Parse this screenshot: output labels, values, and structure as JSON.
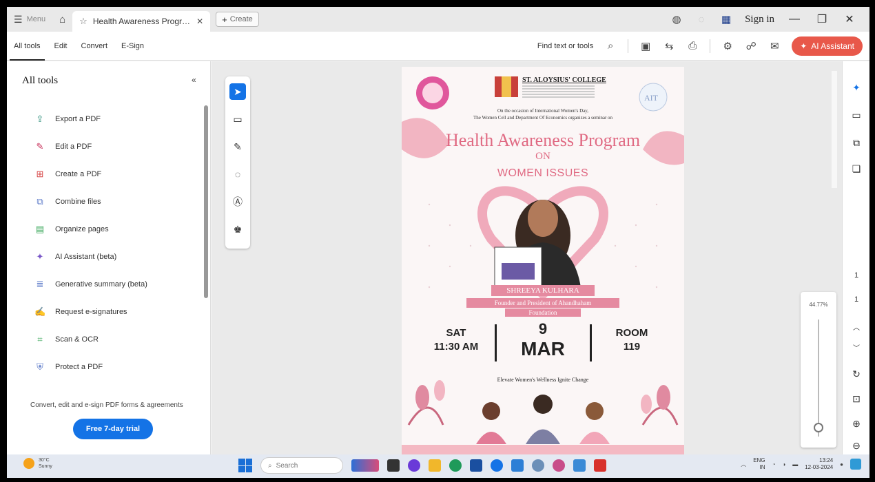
{
  "titlebar": {
    "menu_label": "Menu",
    "tab_title": "Health Awareness Progr…",
    "create_label": "Create",
    "sign_in": "Sign in"
  },
  "toolbar": {
    "tabs": [
      "All tools",
      "Edit",
      "Convert",
      "E-Sign"
    ],
    "find_label": "Find text or tools",
    "ai_label": "AI Assistant"
  },
  "left_panel": {
    "title": "All tools",
    "items": [
      {
        "label": "Export a PDF",
        "icon": "export-pdf-icon",
        "color": "#2d8f7b"
      },
      {
        "label": "Edit a PDF",
        "icon": "edit-pdf-icon",
        "color": "#c8305a"
      },
      {
        "label": "Create a PDF",
        "icon": "create-pdf-icon",
        "color": "#d64545"
      },
      {
        "label": "Combine files",
        "icon": "combine-files-icon",
        "color": "#5a78c8"
      },
      {
        "label": "Organize pages",
        "icon": "organize-pages-icon",
        "color": "#3aa75a"
      },
      {
        "label": "AI Assistant (beta)",
        "icon": "ai-assistant-icon",
        "color": "#7a58c8"
      },
      {
        "label": "Generative summary (beta)",
        "icon": "generative-summary-icon",
        "color": "#5a78c8"
      },
      {
        "label": "Request e-signatures",
        "icon": "request-signatures-icon",
        "color": "#7a58c8"
      },
      {
        "label": "Scan & OCR",
        "icon": "scan-ocr-icon",
        "color": "#3aa75a"
      },
      {
        "label": "Protect a PDF",
        "icon": "protect-pdf-icon",
        "color": "#5a78c8"
      }
    ],
    "promo_text": "Convert, edit and e-sign PDF forms & agreements",
    "trial_button": "Free 7-day trial"
  },
  "poster": {
    "college": "ST. ALOYSIUS' COLLEGE",
    "intro_line1": "On the occasion of International Women's Day,",
    "intro_line2": "The Women Cell and Department Of Economics organizes a seminar on",
    "title": "Health Awareness Program",
    "on": "ON",
    "subtitle": "WOMEN ISSUES",
    "speaker_name": "SHREEYA KULHARA",
    "speaker_role": "Founder and President of Ahandhaham",
    "speaker_role2": "Foundation",
    "day": "SAT",
    "time": "11:30 AM",
    "date": "9",
    "month": "MAR",
    "room_label": "ROOM",
    "room_number": "119",
    "tagline": "Elevate Women's Wellness Ignite Change"
  },
  "zoom": {
    "percent": "44.77%"
  },
  "taskbar": {
    "weather_temp": "30°C",
    "weather_desc": "Sunny",
    "search_placeholder": "Search",
    "lang_line1": "ENG",
    "lang_line2": "IN",
    "time": "13:24",
    "date": "12-03-2024"
  },
  "colors": {
    "accent_red": "#e8584a",
    "trial_blue": "#1473e6",
    "poster_pink": "#e06a83"
  }
}
